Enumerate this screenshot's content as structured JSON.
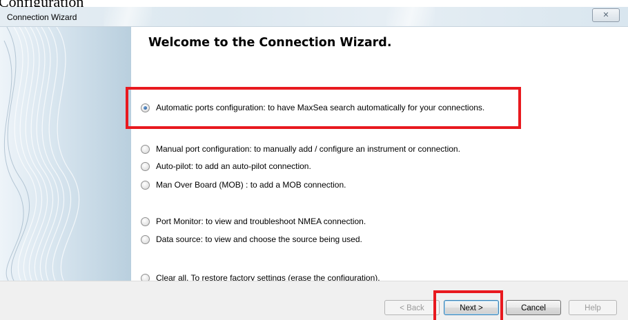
{
  "caption": "Configuration",
  "window": {
    "title": "Connection Wizard",
    "close_glyph": "✕"
  },
  "heading": "Welcome to the Connection Wizard.",
  "options": [
    {
      "label": "Automatic ports configuration: to have MaxSea search automatically for your connections.",
      "selected": true
    },
    {
      "label": "Manual port configuration: to manually add / configure an instrument or connection.",
      "selected": false
    },
    {
      "label": "Auto-pilot: to add an auto-pilot connection.",
      "selected": false
    },
    {
      "label": "Man Over Board (MOB) : to add a MOB connection.",
      "selected": false
    },
    {
      "label": "Port Monitor: to view and troubleshoot NMEA connection.",
      "selected": false
    },
    {
      "label": "Data source: to view and choose the source being used.",
      "selected": false
    },
    {
      "label": "Clear all. To restore factory settings (erase the configuration).",
      "selected": false
    }
  ],
  "buttons": {
    "back": "< Back",
    "next": "Next >",
    "cancel": "Cancel",
    "help": "Help"
  },
  "colors": {
    "highlight": "#e8191f"
  }
}
